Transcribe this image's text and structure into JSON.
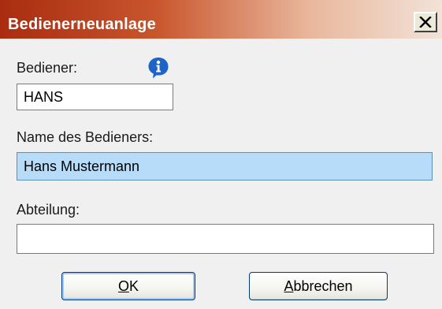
{
  "window": {
    "title": "Bedienerneuanlage"
  },
  "titlebar": {
    "close_icon": "close-x-icon"
  },
  "form": {
    "bediener": {
      "label": "Bediener:",
      "value": "HANS",
      "info_icon": "info-speech-bubble-icon"
    },
    "name": {
      "label": "Name des Bedieners:",
      "value": "Hans Mustermann"
    },
    "abteilung": {
      "label": "Abteilung:",
      "value": ""
    }
  },
  "buttons": {
    "ok": {
      "mnemonic": "O",
      "rest": "K"
    },
    "cancel": {
      "mnemonic": "A",
      "rest": "bbrechen"
    }
  },
  "colors": {
    "title_gradient_start": "#a92c10",
    "title_gradient_end": "#f2e2d8",
    "highlight_field": "#b7dcf9",
    "info_icon": "#1e64c8"
  }
}
